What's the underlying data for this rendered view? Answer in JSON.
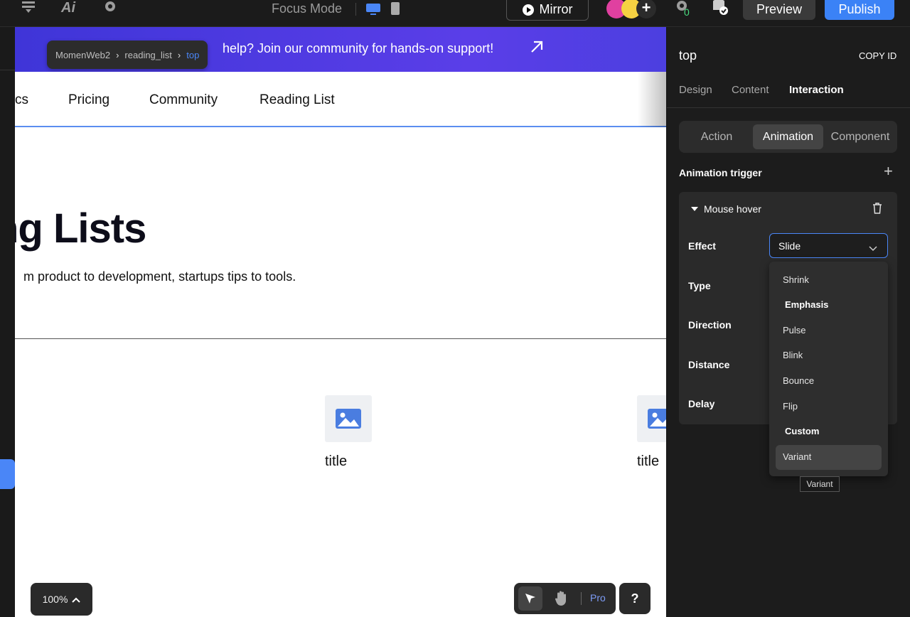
{
  "topbar": {
    "focus_mode": "Focus Mode",
    "mirror_label": "Mirror",
    "preview_label": "Preview",
    "publish_label": "Publish",
    "icons": [
      "layers-icon",
      "ai-icon",
      "settings-icon",
      "desktop-icon",
      "mobile-icon",
      "gear-count-icon",
      "database-icon"
    ],
    "gear_count": "0"
  },
  "canvas": {
    "banner_text": "help? Join our community for hands-on support!",
    "breadcrumb": [
      "MomenWeb2",
      "reading_list",
      "top"
    ],
    "nav": [
      "cs",
      "Pricing",
      "Community",
      "Reading List"
    ],
    "hero_title": "ng Lists",
    "hero_subtitle": "m product to development, startups tips to tools.",
    "cards": [
      {
        "title": "title"
      },
      {
        "title": "title"
      }
    ]
  },
  "bottom": {
    "zoom": "100%",
    "pro_label": "Pro",
    "help_label": "?"
  },
  "panel": {
    "title": "top",
    "copy_id": "COPY ID",
    "tabs": [
      "Design",
      "Content",
      "Interaction"
    ],
    "segments": [
      "Action",
      "Animation",
      "Component"
    ],
    "animation_trigger": "Animation trigger",
    "trigger_name": "Mouse hover",
    "fields": [
      "Effect",
      "Type",
      "Direction",
      "Distance",
      "Delay"
    ],
    "effect_value": "Slide",
    "dropdown": [
      {
        "label": "Shrink",
        "kind": "item"
      },
      {
        "label": "Emphasis",
        "kind": "group"
      },
      {
        "label": "Pulse",
        "kind": "item"
      },
      {
        "label": "Blink",
        "kind": "item"
      },
      {
        "label": "Bounce",
        "kind": "item"
      },
      {
        "label": "Flip",
        "kind": "item"
      },
      {
        "label": "Custom",
        "kind": "group"
      },
      {
        "label": "Variant",
        "kind": "item"
      }
    ],
    "tooltip": "Variant"
  },
  "colors": {
    "accent": "#3b82f6",
    "banner": "#4a3be0",
    "panel_bg": "#1c1c1c"
  }
}
